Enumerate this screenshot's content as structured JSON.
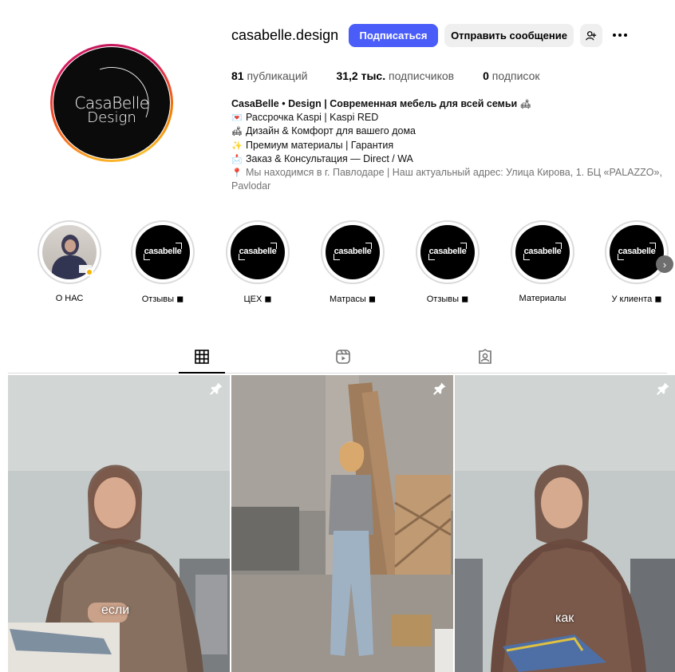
{
  "profile": {
    "username": "casabelle.design",
    "logo": {
      "line1": "CasaBelle",
      "line2": "Design"
    },
    "follow_label": "Подписаться",
    "message_label": "Отправить сообщение"
  },
  "stats": {
    "posts_count": "81",
    "posts_label": "публикаций",
    "followers_count": "31,2 тыс.",
    "followers_label": "подписчиков",
    "following_count": "0",
    "following_label": "подписок"
  },
  "bio": {
    "name": "CasaBelle • Design | Современная мебель для всей семьи",
    "line1": "Рассрочка Kaspi | Kaspi RED",
    "line2": "Дизайн & Комфорт для вашего дома",
    "line3": "Премиум материалы | Гарантия",
    "line4": "Заказ & Консультация — Direct / WA",
    "line5": "Мы находимся в г. Павлодаре | Наш актуальный адрес: Улица Кирова, 1. БЦ «PALAZZO», Pavlodar"
  },
  "highlights": [
    {
      "label": "О НАС",
      "logo": ""
    },
    {
      "label": "Отзывы ◼",
      "logo": "casabelle"
    },
    {
      "label": "ЦЕХ ◼",
      "logo": "casabelle"
    },
    {
      "label": "Матрасы ◼",
      "logo": "casabelle"
    },
    {
      "label": "Отзывы ◼",
      "logo": "casabelle"
    },
    {
      "label": "Материалы",
      "logo": "casabelle"
    },
    {
      "label": "У клиента ◼",
      "logo": "casabelle"
    }
  ],
  "tabs": [
    {
      "icon": "grid-icon",
      "active": true
    },
    {
      "icon": "reels-icon",
      "active": false
    },
    {
      "icon": "tagged-icon",
      "active": false
    }
  ],
  "posts": [
    {
      "caption": "если",
      "pinned": true
    },
    {
      "caption": "",
      "pinned": true
    },
    {
      "caption": "как",
      "pinned": true
    }
  ],
  "colors": {
    "follow_button": "#4a5df9",
    "secondary_button": "#efefef",
    "ring_gradient": [
      "#f9a825",
      "#d81b60"
    ]
  }
}
